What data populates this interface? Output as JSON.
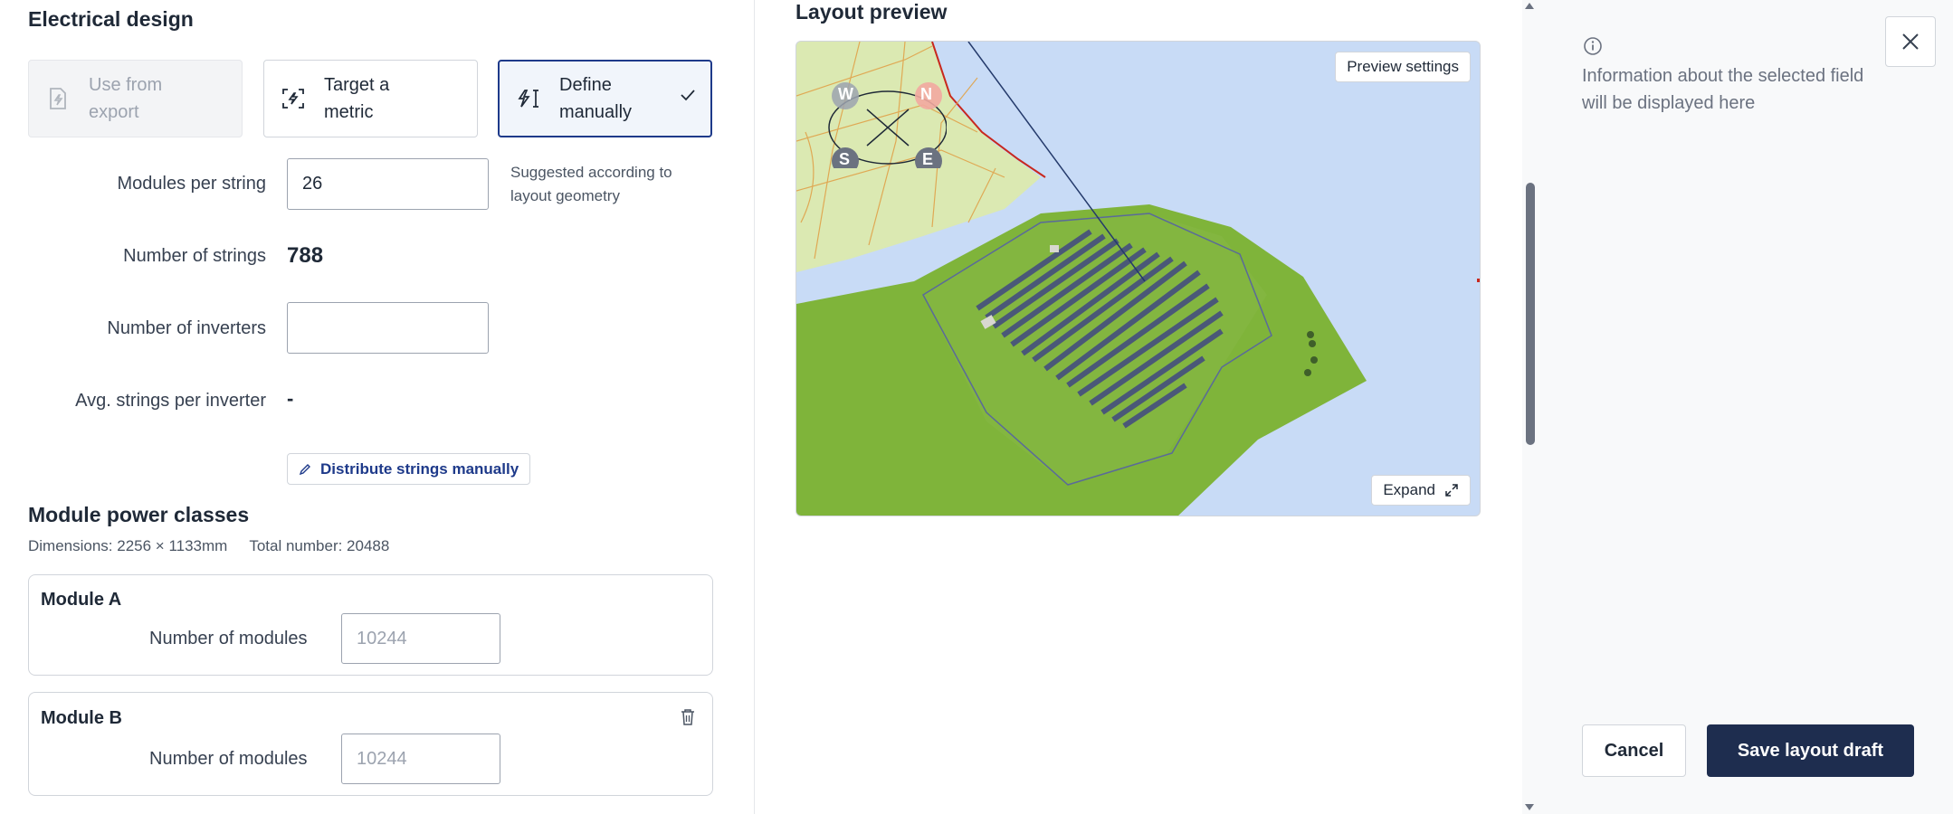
{
  "electrical": {
    "title": "Electrical design",
    "modes": [
      {
        "label": "Use from export",
        "state": "disabled",
        "icon": "file-bolt-icon"
      },
      {
        "label": "Target a metric",
        "state": "default",
        "icon": "target-bolt-icon"
      },
      {
        "label": "Define manually",
        "state": "selected",
        "icon": "bolt-text-cursor-icon"
      }
    ],
    "modules_per_string": {
      "label": "Modules per string",
      "value": "26",
      "hint": "Suggested according to layout geometry"
    },
    "number_of_strings": {
      "label": "Number of strings",
      "value": "788"
    },
    "number_of_inverters": {
      "label": "Number of inverters",
      "value": ""
    },
    "avg_strings": {
      "label": "Avg. strings per inverter",
      "value": "-"
    },
    "distribute_label": "Distribute strings manually"
  },
  "power_classes": {
    "title": "Module power classes",
    "dimensions": "Dimensions: 2256 × 1133mm",
    "total": "Total number: 20488",
    "modules": [
      {
        "name": "Module A",
        "label": "Number of modules",
        "placeholder": "10244"
      },
      {
        "name": "Module B",
        "label": "Number of modules",
        "placeholder": "10244"
      }
    ]
  },
  "preview": {
    "title": "Layout preview",
    "settings_label": "Preview settings",
    "expand_label": "Expand",
    "compass": {
      "w": "W",
      "n": "N",
      "s": "S",
      "e": "E"
    }
  },
  "side_panel": {
    "info_text": "Information about the selected field will be displayed here",
    "cancel_label": "Cancel",
    "save_label": "Save layout draft"
  },
  "colors": {
    "accent": "#1e3a8a",
    "primary_button": "#1e2d4f",
    "terrain": "#7fb43a",
    "water": "#c8dbf6",
    "land_light": "#dbe9b2"
  }
}
